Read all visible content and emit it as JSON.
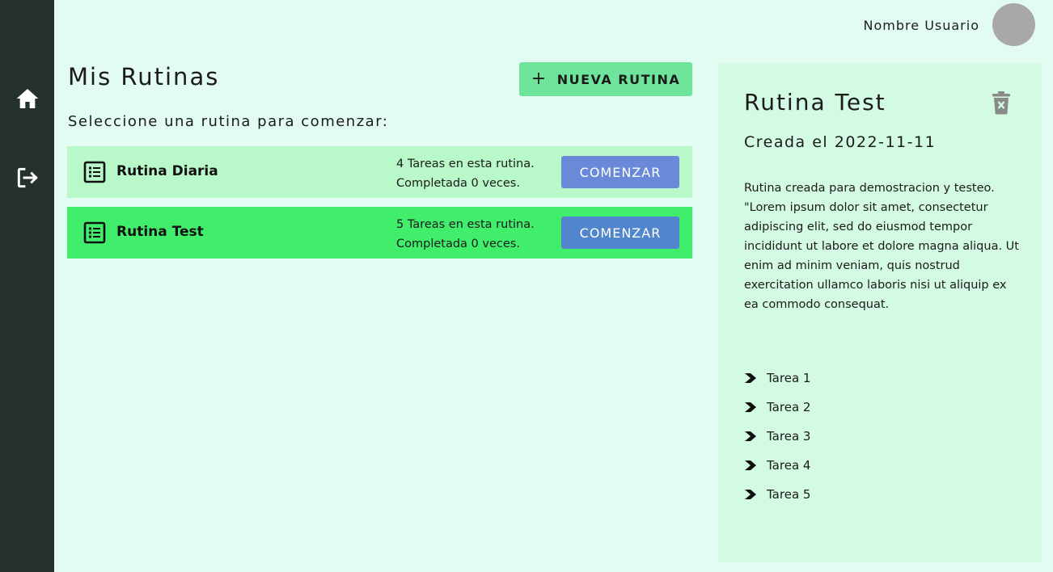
{
  "sidebar": {
    "items": [
      {
        "name": "home",
        "icon": "home-icon"
      },
      {
        "name": "logout",
        "icon": "logout-icon"
      }
    ]
  },
  "header": {
    "user_name": "Nombre Usuario"
  },
  "main": {
    "title": "Mis Rutinas",
    "new_button_label": "NUEVA RUTINA",
    "subtitle": "Seleccione una rutina para comenzar:",
    "routines": [
      {
        "name": "Rutina Diaria",
        "tasks_text": "4 Tareas en esta rutina.",
        "completed_text": "Completada 0 veces.",
        "button_label": "COMENZAR"
      },
      {
        "name": "Rutina Test",
        "tasks_text": "5 Tareas en esta rutina.",
        "completed_text": "Completada 0 veces.",
        "button_label": "COMENZAR"
      }
    ]
  },
  "detail": {
    "title": "Rutina Test",
    "created": "Creada el 2022-11-11",
    "description": "Rutina creada para demostracion y testeo. \"Lorem ipsum dolor sit amet, consectetur adipiscing elit, sed do eiusmod tempor incididunt ut labore et dolore magna aliqua. Ut enim ad minim veniam, quis nostrud exercitation ullamco laboris nisi ut aliquip ex ea commodo consequat.",
    "tasks": [
      "Tarea 1",
      "Tarea 2",
      "Tarea 3",
      "Tarea 4",
      "Tarea 5"
    ]
  },
  "colors": {
    "background": "#e2fcf1",
    "sidebar": "#24312e",
    "new_button": "#6ee59b",
    "routine_default": "#b9f8c8",
    "routine_selected": "#40ee6c",
    "start_button": "#6a89d8",
    "detail_panel": "#d3fae3"
  }
}
